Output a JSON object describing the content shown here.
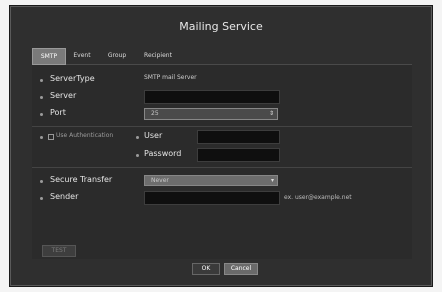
{
  "window": {
    "title": "Mailing Service"
  },
  "tabs": [
    {
      "label": "SMTP",
      "active": true
    },
    {
      "label": "Event",
      "active": false
    },
    {
      "label": "Group",
      "active": false
    },
    {
      "label": "Recipient",
      "active": false
    }
  ],
  "form": {
    "server_type_label": "ServerType",
    "server_type_value": "SMTP mail Server",
    "server_label": "Server",
    "server_value": "",
    "port_label": "Port",
    "port_value": "25",
    "use_auth_label": "Use Authentication",
    "user_label": "User",
    "user_value": "",
    "password_label": "Password",
    "password_value": "",
    "secure_transfer_label": "Secure Transfer",
    "secure_transfer_value": "Never",
    "sender_label": "Sender",
    "sender_value": "",
    "sender_hint": "ex. user@example.net"
  },
  "buttons": {
    "test": "TEST",
    "ok": "OK",
    "cancel": "Cancel"
  },
  "icons": {
    "stepper": "stepper-arrows-icon",
    "dropdown": "chevron-down-icon"
  },
  "colors": {
    "window_bg": "#2f2f2f",
    "tab_active": "#7a7a7a",
    "field_bg": "#0f0f0f"
  }
}
